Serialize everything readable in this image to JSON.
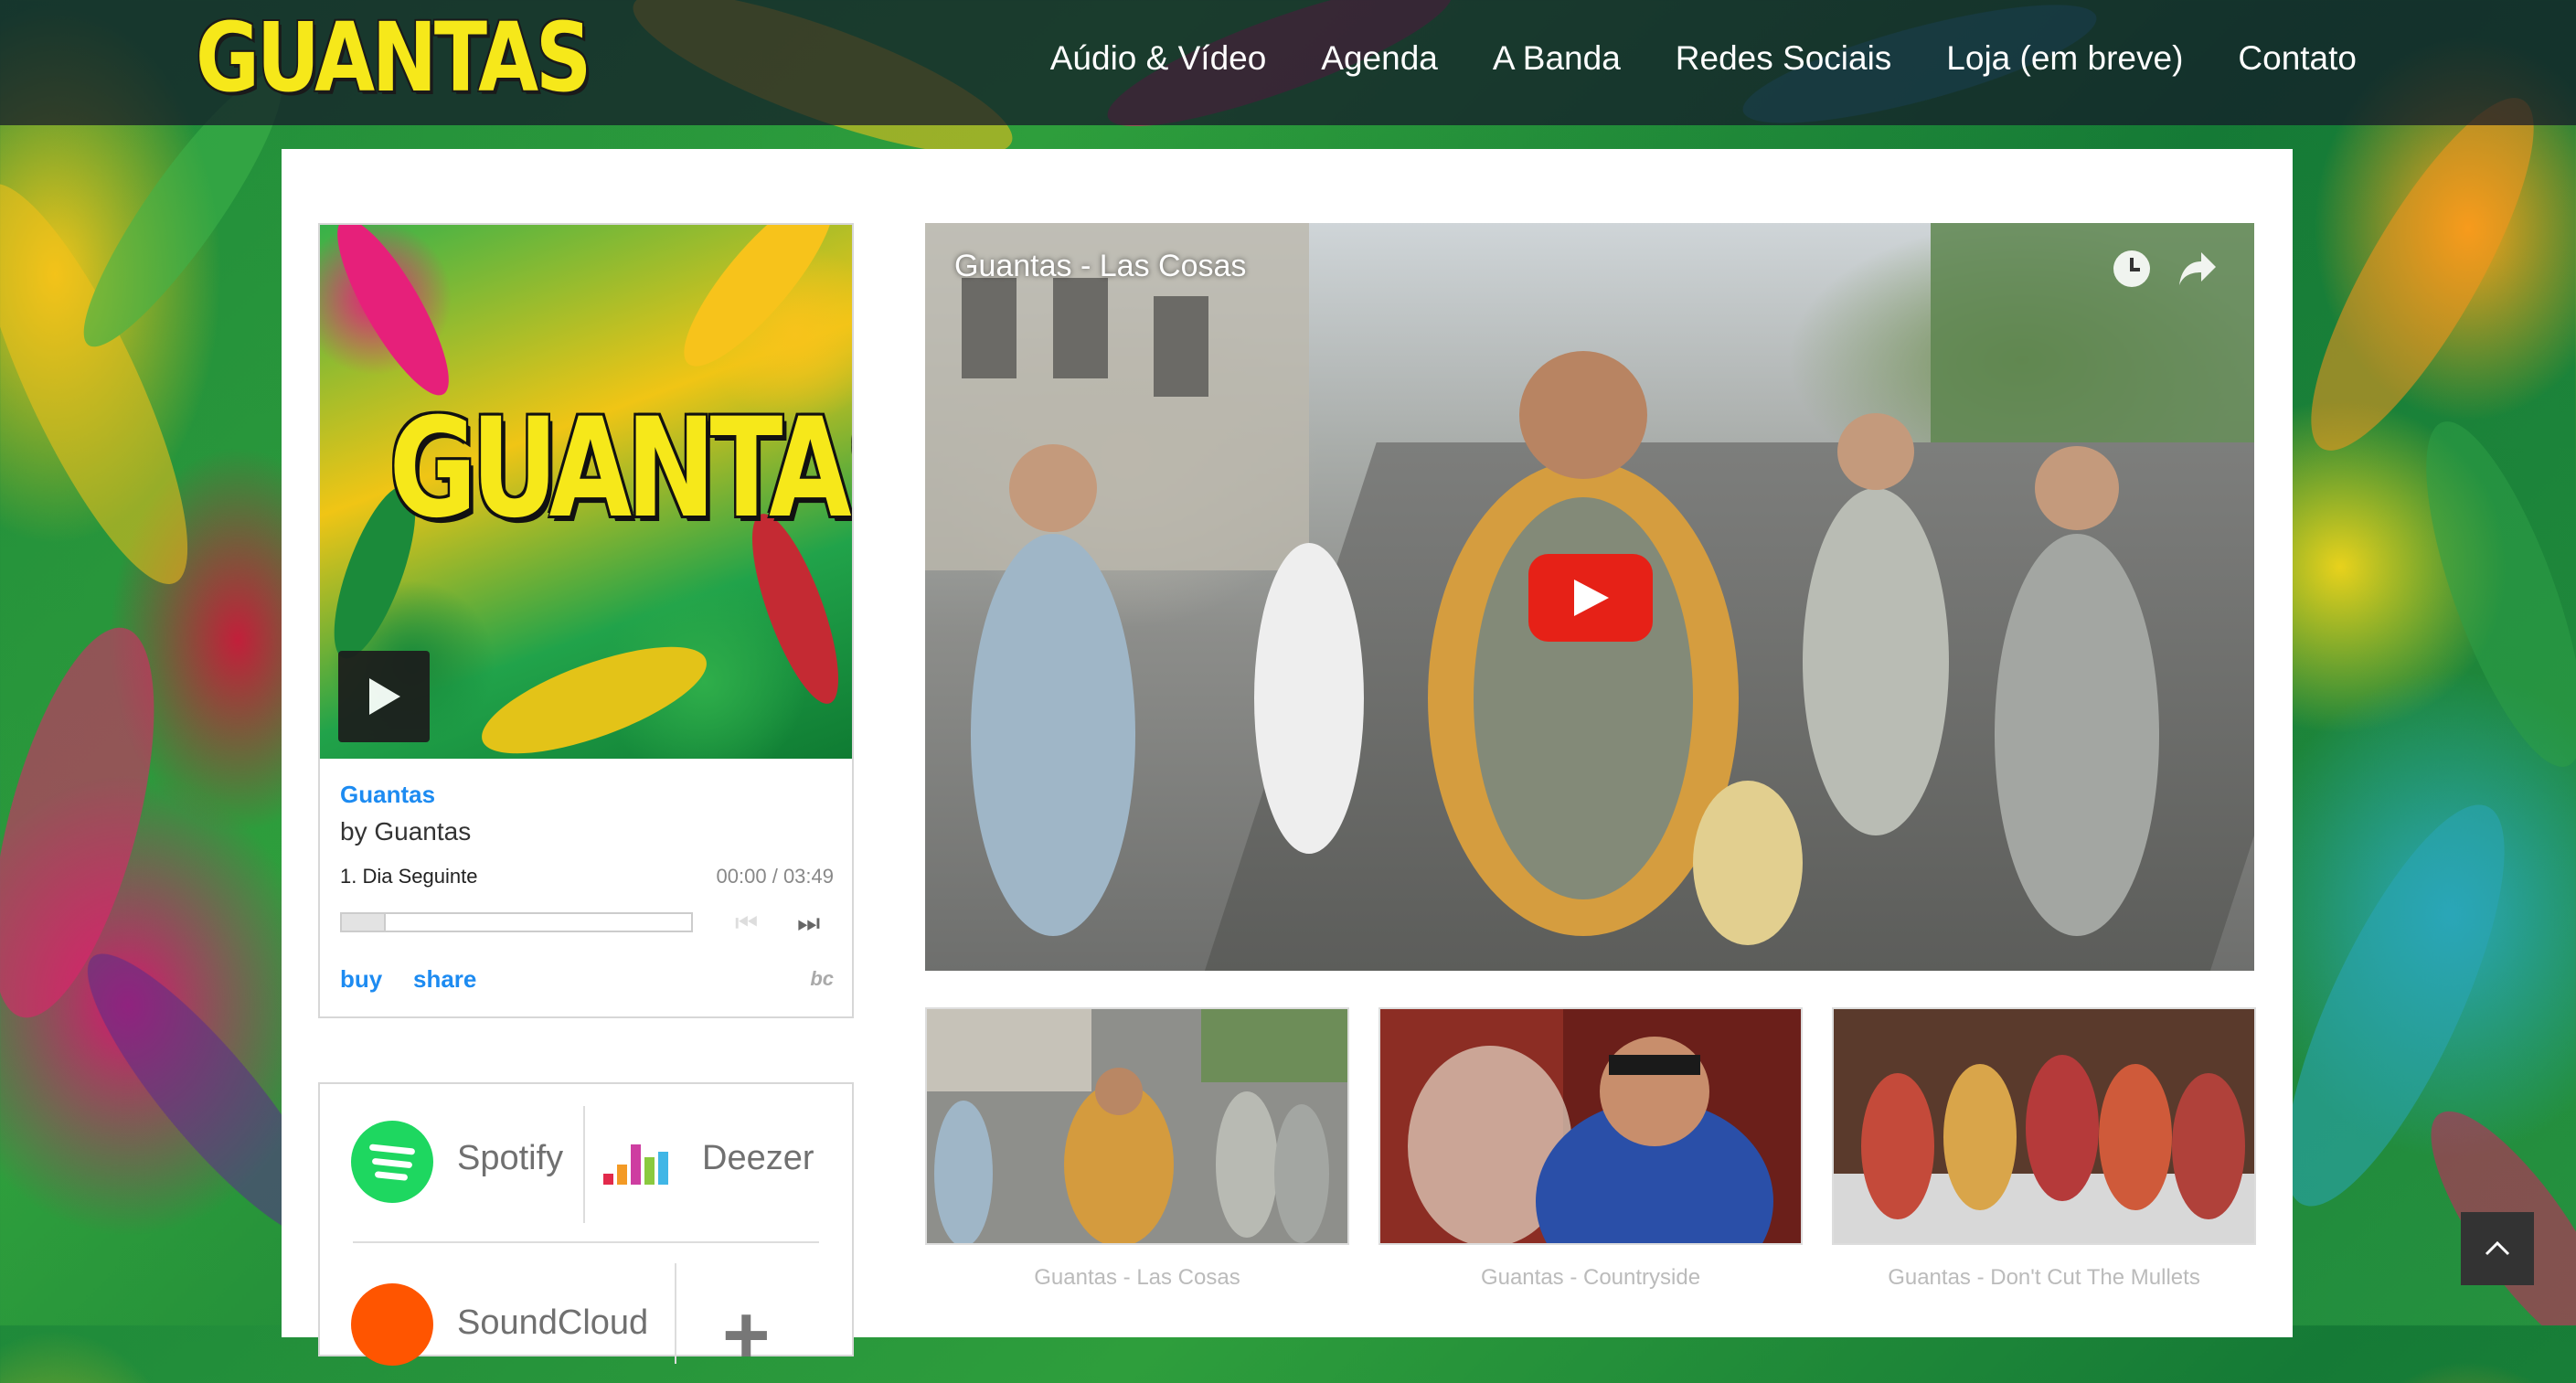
{
  "header": {
    "logo_text": "GUANTAS",
    "nav": [
      "Aúdio & Vídeo",
      "Agenda",
      "A Banda",
      "Redes Sociais",
      "Loja (em breve)",
      "Contato"
    ]
  },
  "bandcamp": {
    "cover_text": "GUANTAS",
    "album": "Guantas",
    "artist": "by Guantas",
    "track": "1.  Dia Seguinte",
    "time": "00:00 / 03:49",
    "progress_fraction": 0,
    "buy_label": "buy",
    "share_label": "share",
    "logo_text": "bc"
  },
  "streaming": {
    "services": [
      "Spotify",
      "Deezer",
      "SoundCloud"
    ]
  },
  "video": {
    "title": "Guantas - Las Cosas",
    "icons": [
      "watch-later-icon",
      "share-icon",
      "play-icon"
    ]
  },
  "playlist": [
    {
      "label": "Guantas - Las Cosas"
    },
    {
      "label": "Guantas - Countryside"
    },
    {
      "label": "Guantas - Don't Cut The Mullets"
    }
  ],
  "colors": {
    "logo_yellow": "#f6e81a",
    "link_blue": "#1d8bf1",
    "youtube_red": "#e62117",
    "spotify_green": "#1ed760",
    "soundcloud_orange": "#ff5500"
  }
}
